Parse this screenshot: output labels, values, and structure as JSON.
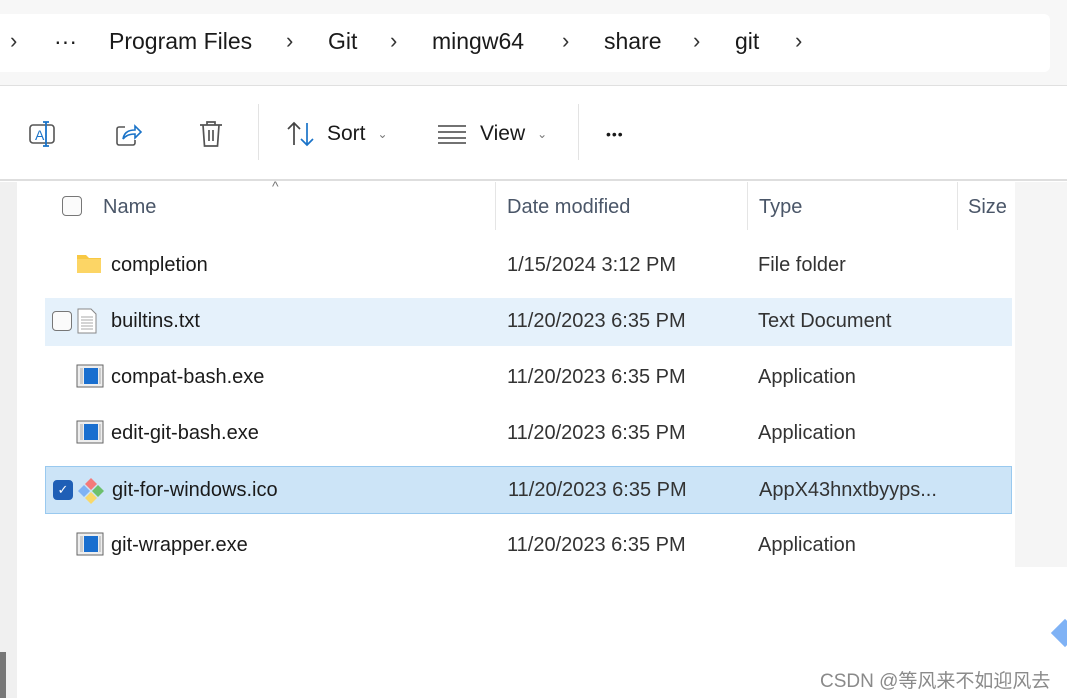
{
  "breadcrumb": {
    "ellipsis": "···",
    "items": [
      "Program Files",
      "Git",
      "mingw64",
      "share",
      "git"
    ]
  },
  "toolbar": {
    "sort_label": "Sort",
    "view_label": "View",
    "more_label": "•••"
  },
  "columns": {
    "name": "Name",
    "date": "Date modified",
    "type": "Type",
    "size": "Size"
  },
  "files": [
    {
      "name": "completion",
      "date": "1/15/2024 3:12 PM",
      "type": "File folder",
      "icon": "folder-icon"
    },
    {
      "name": "builtins.txt",
      "date": "11/20/2023 6:35 PM",
      "type": "Text Document",
      "icon": "text-file-icon",
      "state": "hover"
    },
    {
      "name": "compat-bash.exe",
      "date": "11/20/2023 6:35 PM",
      "type": "Application",
      "icon": "application-icon"
    },
    {
      "name": "edit-git-bash.exe",
      "date": "11/20/2023 6:35 PM",
      "type": "Application",
      "icon": "application-icon"
    },
    {
      "name": "git-for-windows.ico",
      "date": "11/20/2023 6:35 PM",
      "type": "AppX43hnxtbyyps...",
      "icon": "git-icon",
      "state": "selected"
    },
    {
      "name": "git-wrapper.exe",
      "date": "11/20/2023 6:35 PM",
      "type": "Application",
      "icon": "application-icon"
    }
  ],
  "watermark": "CSDN @等风来不如迎风去"
}
